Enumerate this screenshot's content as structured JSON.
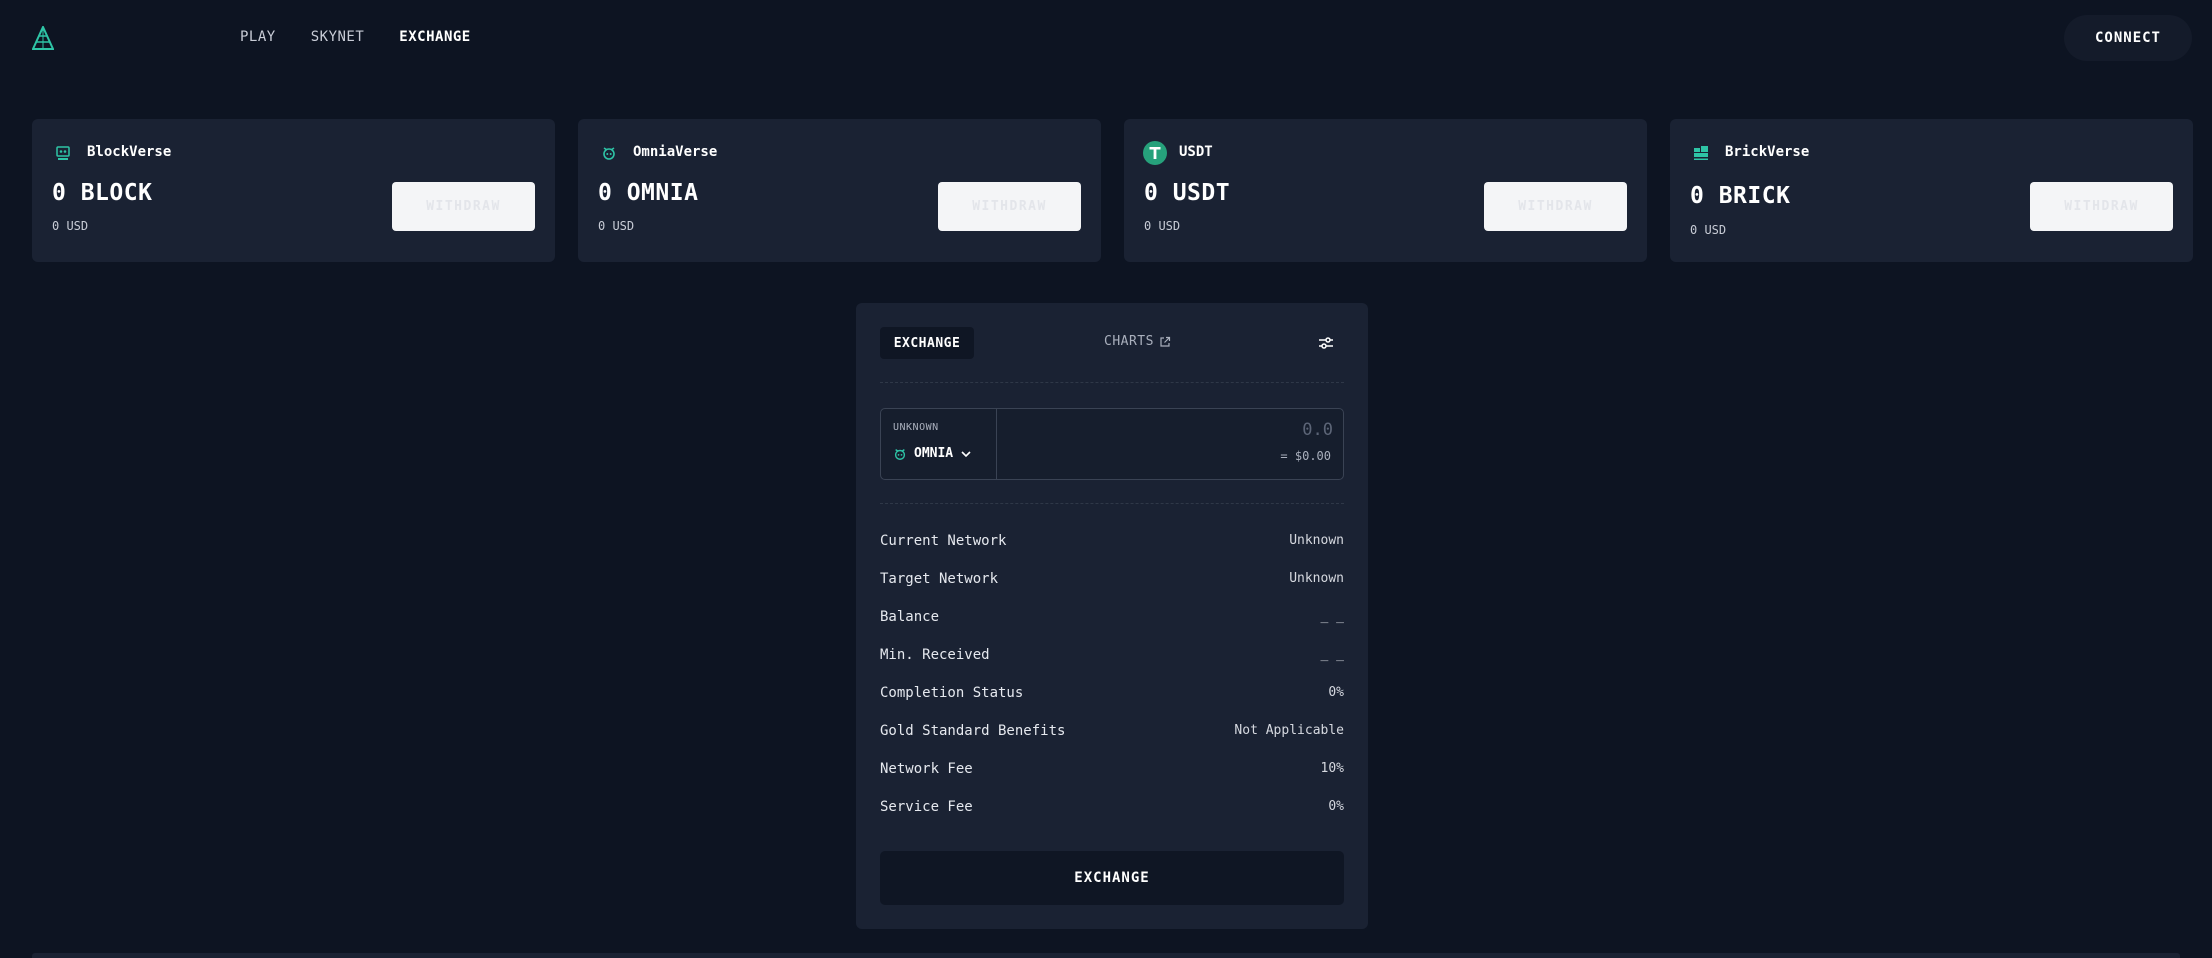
{
  "header": {
    "logo": "pyramid-logo-icon",
    "nav": [
      {
        "label": "PLAY",
        "active": false
      },
      {
        "label": "SKYNET",
        "active": false
      },
      {
        "label": "EXCHANGE",
        "active": true
      }
    ],
    "connect_label": "CONNECT"
  },
  "cards": [
    {
      "name": "BlockVerse",
      "amount": "0 BLOCK",
      "usd": "0 USD",
      "button": "WITHDRAW",
      "icon": "blockverse-icon"
    },
    {
      "name": "OmniaVerse",
      "amount": "0 OMNIA",
      "usd": "0 USD",
      "button": "WITHDRAW",
      "icon": "omniaverse-icon"
    },
    {
      "name": "USDT",
      "amount": "0 USDT",
      "usd": "0 USD",
      "button": "WITHDRAW",
      "icon": "usdt-icon"
    },
    {
      "name": "BrickVerse",
      "amount": "0 BRICK",
      "usd": "0 USD",
      "button": "WITHDRAW",
      "icon": "brickverse-icon"
    }
  ],
  "panel": {
    "tab_exchange": "EXCHANGE",
    "tab_charts": "CHARTS",
    "token": {
      "network": "UNKNOWN",
      "symbol": "OMNIA"
    },
    "amount_placeholder": "0.0",
    "amount_usd": "= $0.00",
    "rows": [
      {
        "label": "Current Network",
        "value": "Unknown"
      },
      {
        "label": "Target Network",
        "value": "Unknown"
      },
      {
        "label": "Balance",
        "value": "_ _"
      },
      {
        "label": "Min. Received",
        "value": "_ _"
      },
      {
        "label": "Completion Status",
        "value": "0%"
      },
      {
        "label": "Gold Standard Benefits",
        "value": "Not Applicable"
      },
      {
        "label": "Network Fee",
        "value": "10%"
      },
      {
        "label": "Service Fee",
        "value": "0%"
      }
    ],
    "exchange_button": "EXCHANGE"
  },
  "colors": {
    "background": "#0d1422",
    "card": "#1a2233",
    "accent_teal": "#2ec4a6",
    "usdt_green": "#26a17b"
  }
}
